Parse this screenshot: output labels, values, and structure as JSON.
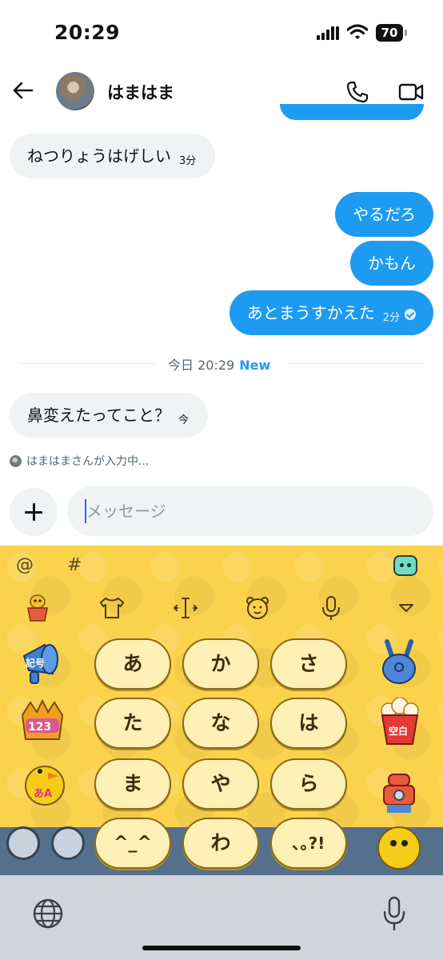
{
  "status_bar": {
    "time": "20:29",
    "battery": "70"
  },
  "header": {
    "contact_name": "はまはま"
  },
  "messages": [
    {
      "direction": "in",
      "text": "ねつりょうはげしい",
      "time": "3分"
    },
    {
      "direction": "out",
      "text": "やるだろ"
    },
    {
      "direction": "out",
      "text": "かもん"
    },
    {
      "direction": "out",
      "text": "あとまうすかえた",
      "time": "2分",
      "read": true
    },
    {
      "direction": "in",
      "text": "鼻変えたってこと？",
      "time": "今"
    }
  ],
  "divider": {
    "label": "今日 20:29",
    "badge": "New"
  },
  "typing": {
    "text": "はまはまさんが入力中..."
  },
  "composer": {
    "placeholder": "メッセージ"
  },
  "keyboard": {
    "symbols": [
      "@",
      "#"
    ],
    "keys": [
      "あ",
      "か",
      "さ",
      "た",
      "な",
      "は",
      "ま",
      "や",
      "ら",
      "^_^",
      "わ",
      "､｡?!"
    ],
    "side_labels": {
      "kigo": "記号",
      "num": "123",
      "kana": "あA",
      "space": "空白"
    },
    "accent_color": "#fbd24c"
  },
  "colors": {
    "brand": "#1d9bf0",
    "incoming_bubble": "#eff3f4"
  }
}
